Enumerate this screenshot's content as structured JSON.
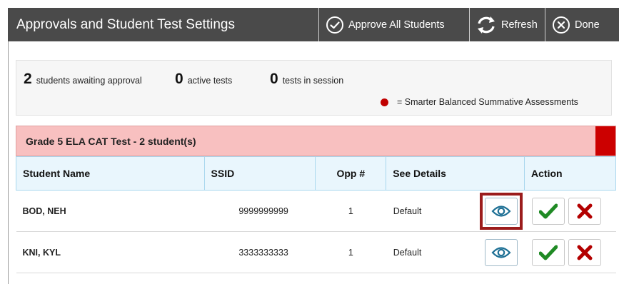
{
  "header": {
    "title": "Approvals and Student Test Settings",
    "approve_all_label": "Approve All Students",
    "refresh_label": "Refresh",
    "done_label": "Done"
  },
  "summary": {
    "awaiting_count": "2",
    "awaiting_label": "students awaiting approval",
    "active_count": "0",
    "active_label": "active tests",
    "session_count": "0",
    "session_label": "tests in session",
    "legend_label": "= Smarter Balanced Summative Assessments",
    "legend_color": "#c00000"
  },
  "test_group": {
    "title": "Grade 5 ELA CAT Test - 2 student(s)",
    "bar_color": "#f8c0c0",
    "flag_color": "#cc0000"
  },
  "table": {
    "headers": {
      "name": "Student Name",
      "ssid": "SSID",
      "opp": "Opp #",
      "details": "See Details",
      "action": "Action"
    },
    "rows": [
      {
        "name": "BOD, NEH",
        "ssid": "9999999999",
        "opp": "1",
        "details": "Default"
      },
      {
        "name": "KNI, KYL",
        "ssid": "3333333333",
        "opp": "1",
        "details": "Default"
      }
    ]
  },
  "icons": {
    "approve_all": "check-circle-icon",
    "refresh": "refresh-icon",
    "done": "close-circle-icon",
    "view": "eye-icon",
    "approve": "checkmark-icon",
    "deny": "x-icon"
  },
  "colors": {
    "header_bg": "#4a4a4a",
    "approve_green": "#1f8a24",
    "deny_red": "#b30000",
    "eye_blue": "#1d6f94",
    "highlight": "#9b1c1c"
  }
}
